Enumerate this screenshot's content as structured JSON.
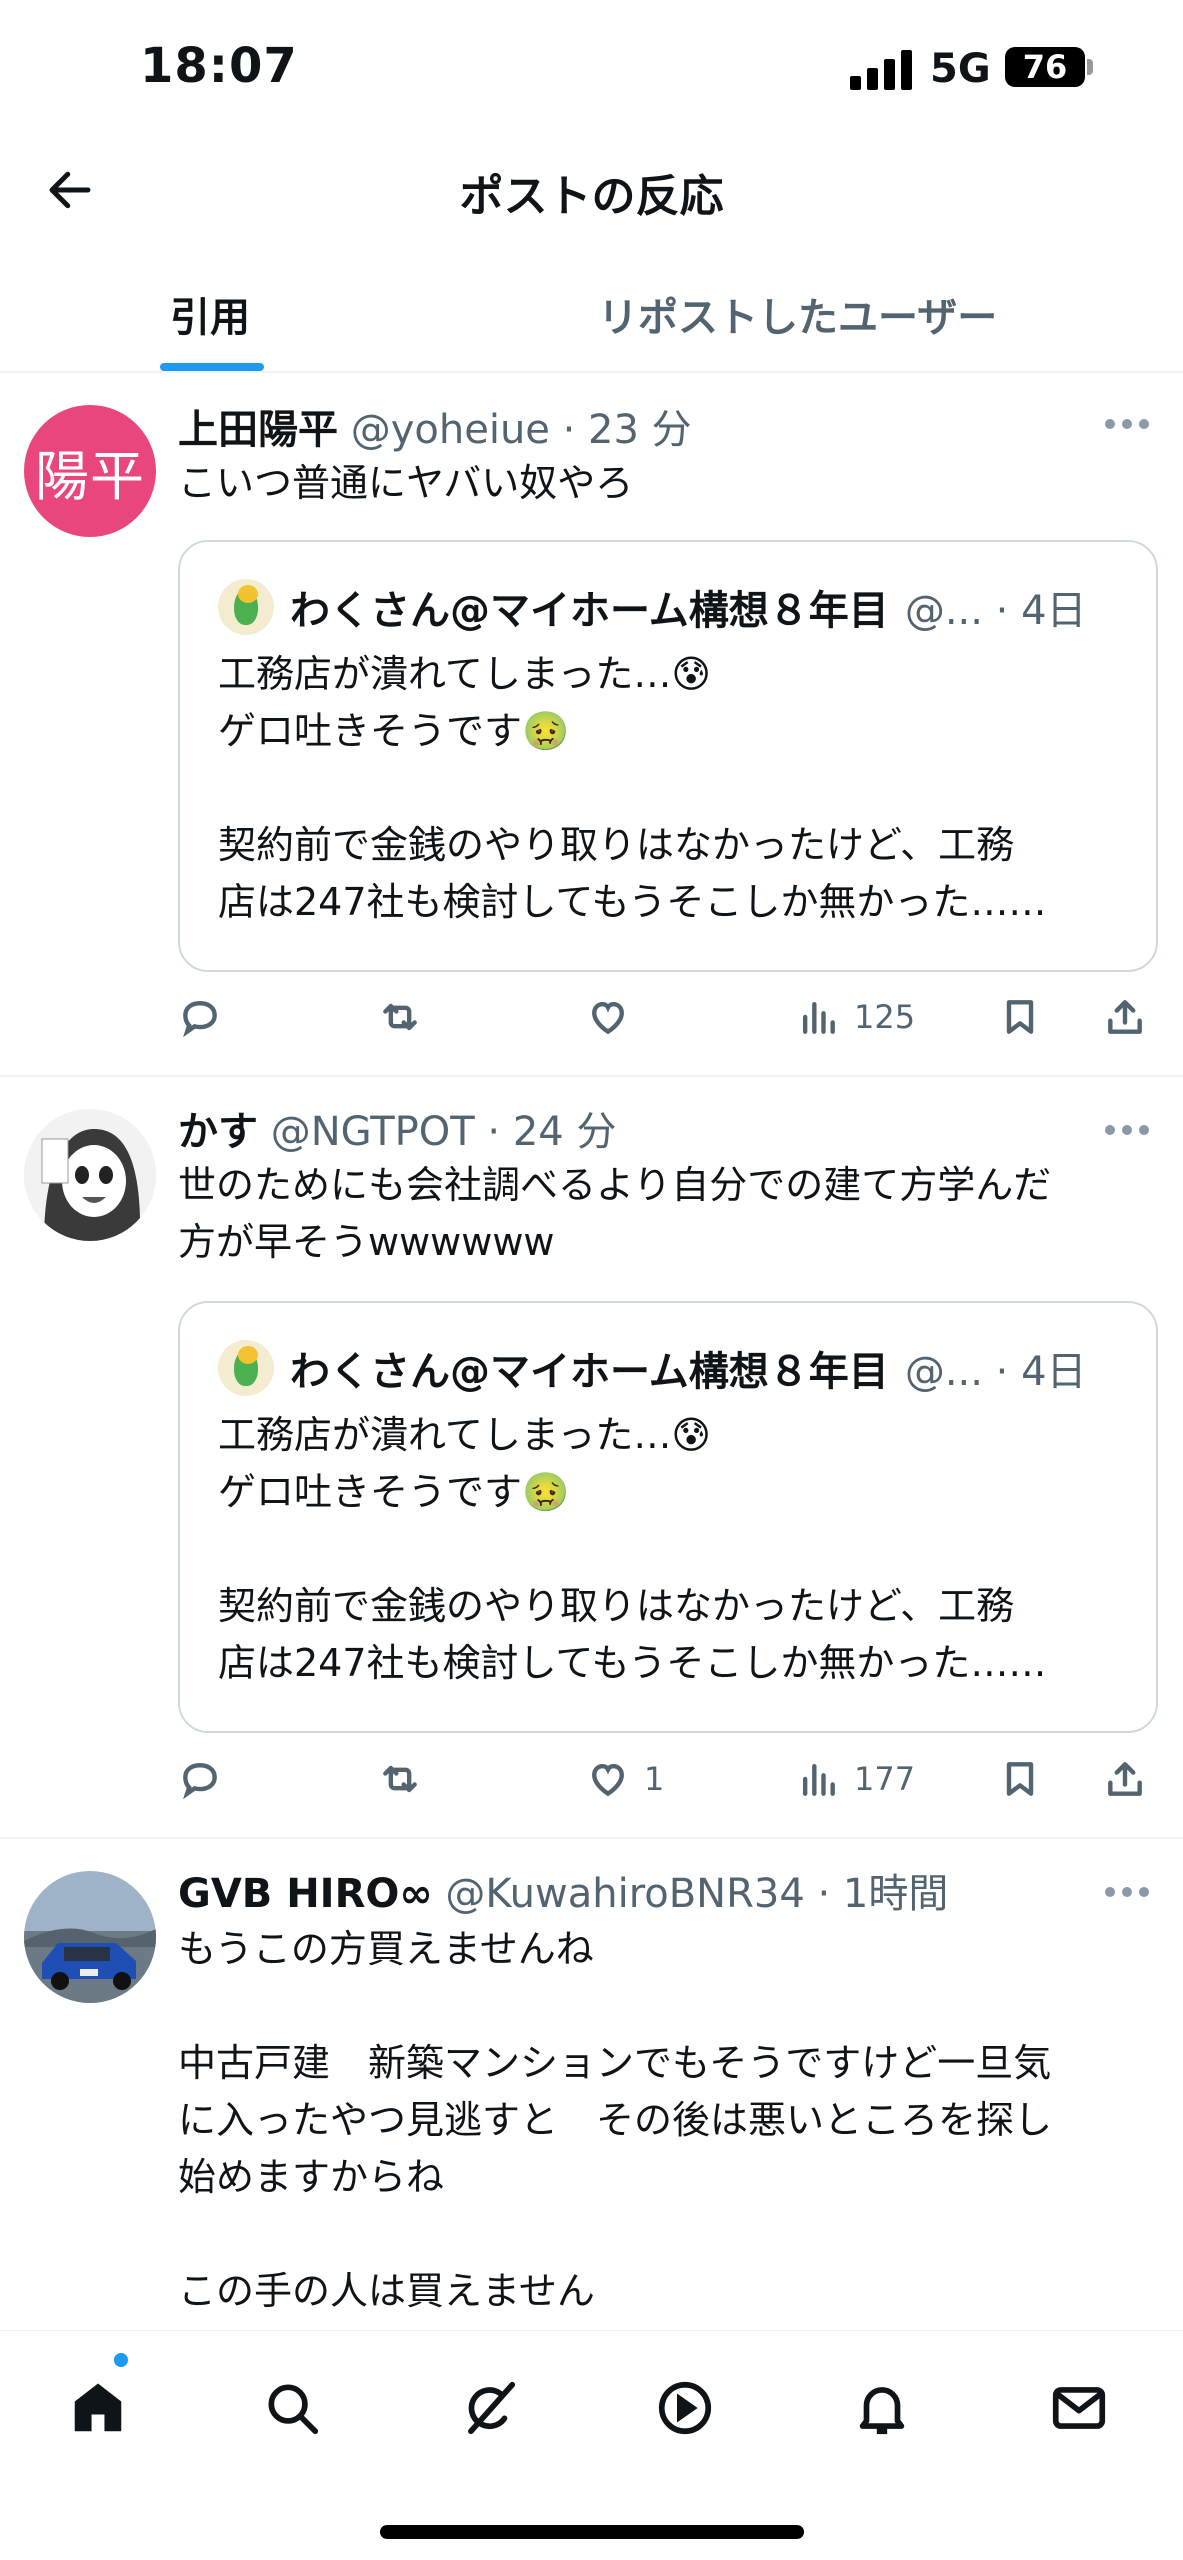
{
  "status_bar": {
    "time": "18:07",
    "network": "5G",
    "battery": "76"
  },
  "header": {
    "title": "ポストの反応"
  },
  "tabs": [
    {
      "label": "引用",
      "selected": true
    },
    {
      "label": "リポストしたユーザー",
      "selected": false
    }
  ],
  "colors": {
    "accent": "#1d9bf0",
    "secondary_text": "#536471",
    "avatar_pink": "#e8467c"
  },
  "posts": [
    {
      "avatar_text": "陽平",
      "name": "上田陽平",
      "meta": "@yoheiue · 23 分",
      "text": "こいつ普通にヤバい奴やろ",
      "quote": {
        "name": "わくさん@マイホーム構想８年目",
        "meta": "@... · 4日",
        "text": "工務店が潰れてしまった…😰\nゲロ吐きそうです🤢\n\n契約前で金銭のやり取りはなかったけど、工務\n店は247社も検討してもうそこしか無かった……"
      },
      "stats": {
        "likes": "",
        "views": "125"
      }
    },
    {
      "avatar_text": "",
      "name": "かす",
      "meta": "@NGTPOT · 24 分",
      "text": "世のためにも会社調べるより自分での建て方学んだ\n方が早そうwwwwww",
      "quote": {
        "name": "わくさん@マイホーム構想８年目",
        "meta": "@... · 4日",
        "text": "工務店が潰れてしまった…😰\nゲロ吐きそうです🤢\n\n契約前で金銭のやり取りはなかったけど、工務\n店は247社も検討してもうそこしか無かった……"
      },
      "stats": {
        "likes": "1",
        "views": "177"
      }
    },
    {
      "avatar_text": "",
      "name": "GVB HIRO∞",
      "meta": "@KuwahiroBNR34 · 1時間",
      "text": "もうこの方買えませんね\n\n中古戸建　新築マンションでもそうですけど一旦気\nに入ったやつ見逃すと　その後は悪いところを探し\n始めますからね\n\nこの手の人は買えません"
    }
  ],
  "icons": {
    "back": "arrow-left-icon",
    "more": "more-dots-icon",
    "reply": "reply-icon",
    "repost": "repost-icon",
    "like": "heart-icon",
    "views": "views-icon",
    "bookmark": "bookmark-icon",
    "share": "share-icon",
    "nav": [
      "home-icon",
      "search-icon",
      "grok-icon",
      "play-icon",
      "bell-icon",
      "mail-icon"
    ]
  }
}
